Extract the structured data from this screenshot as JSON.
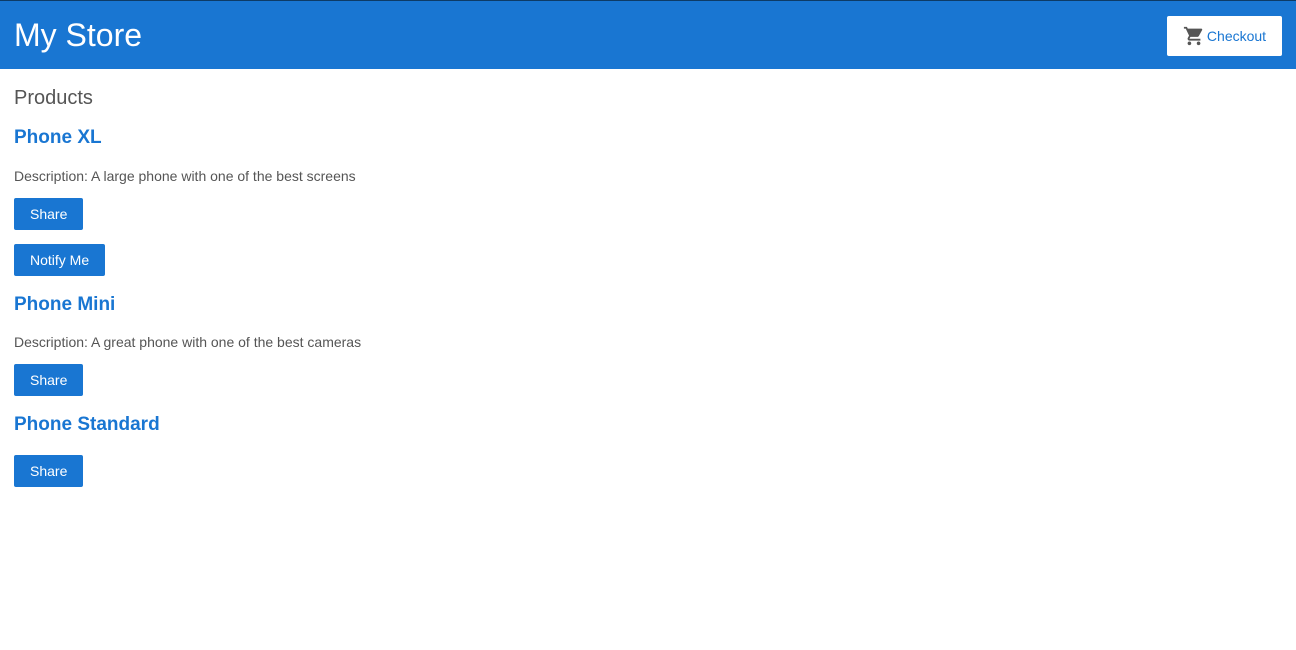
{
  "header": {
    "title": "My Store",
    "checkout_label": "Checkout",
    "cart_icon": "shopping-cart-icon"
  },
  "main": {
    "heading": "Products",
    "products": [
      {
        "name": "Phone XL",
        "description": "Description: A large phone with one of the best screens",
        "share_label": "Share",
        "notify_label": "Notify Me"
      },
      {
        "name": "Phone Mini",
        "description": "Description: A great phone with one of the best cameras",
        "share_label": "Share"
      },
      {
        "name": "Phone Standard",
        "share_label": "Share"
      }
    ]
  },
  "colors": {
    "brand": "#1976d2",
    "text": "#555555",
    "background": "#ffffff"
  }
}
